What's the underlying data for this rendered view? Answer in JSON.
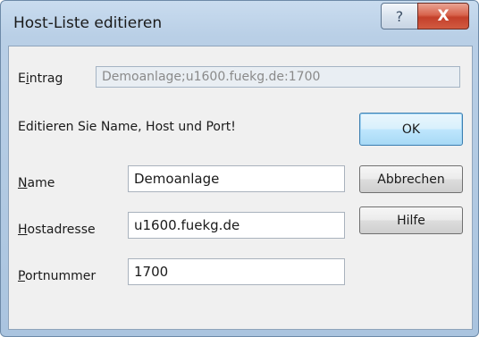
{
  "window": {
    "title": "Host-Liste editieren",
    "help_icon": "?",
    "close_icon": "X"
  },
  "form": {
    "entry_label_pre": "E",
    "entry_label_ul": "i",
    "entry_label_post": "ntrag",
    "entry_value": "Demoanlage;u1600.fuekg.de:1700",
    "instruction": "Editieren Sie Name, Host und Port!",
    "name_label_ul": "N",
    "name_label_post": "ame",
    "name_value": "Demoanlage",
    "host_label_ul": "H",
    "host_label_post": "ostadresse",
    "host_value": "u1600.fuekg.de",
    "port_label_ul": "P",
    "port_label_post": "ortnummer",
    "port_value": "1700"
  },
  "buttons": {
    "ok": "OK",
    "cancel": "Abbrechen",
    "help": "Hilfe"
  }
}
